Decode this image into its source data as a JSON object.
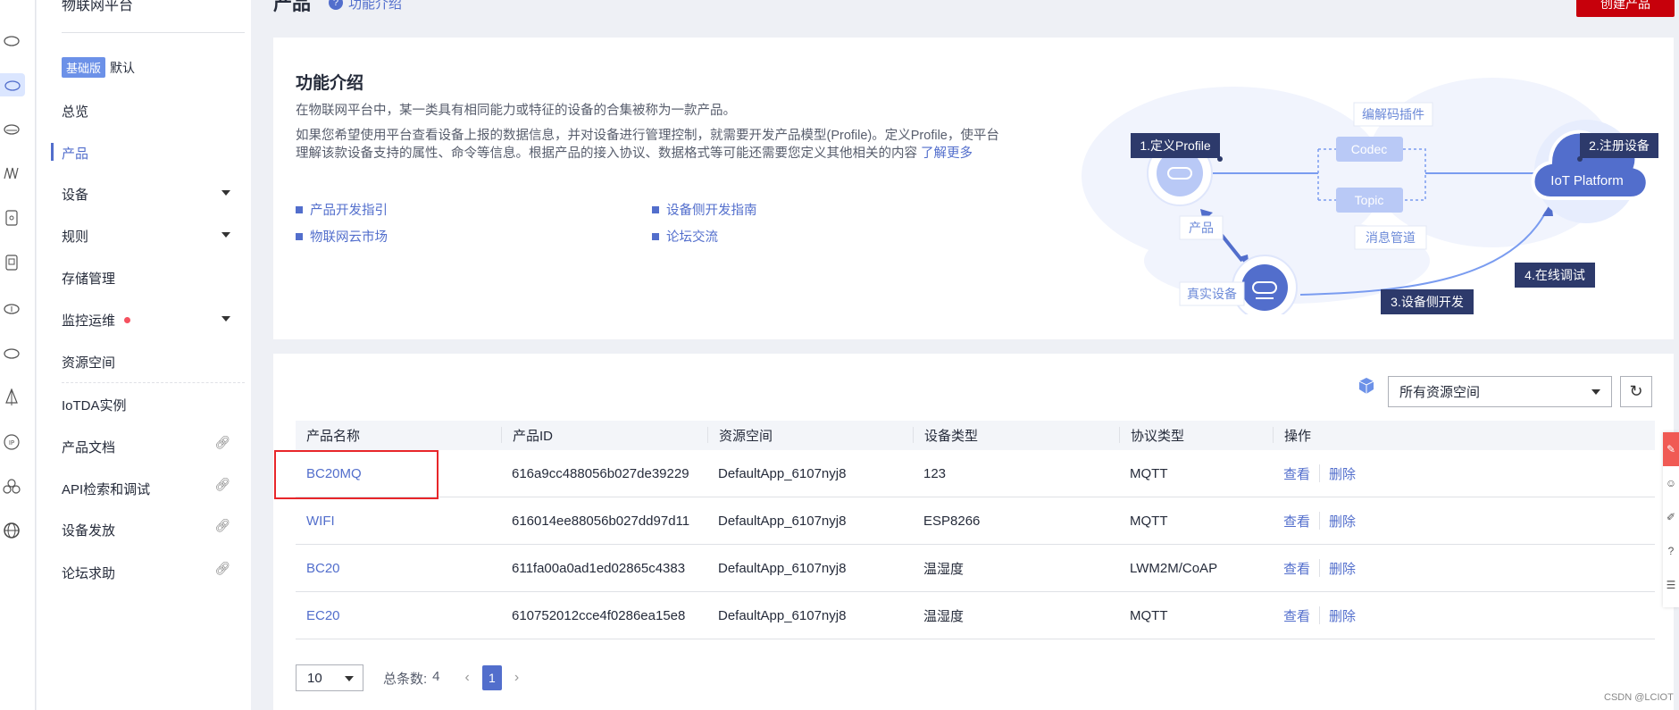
{
  "app": {
    "title": "物联网平台",
    "edition_badge": "基础版",
    "edition_text": "默认"
  },
  "sidebar": {
    "items": [
      {
        "label": "总览"
      },
      {
        "label": "产品",
        "active": true
      },
      {
        "label": "设备"
      },
      {
        "label": "规则"
      },
      {
        "label": "存储管理"
      },
      {
        "label": "监控运维"
      },
      {
        "label": "资源空间"
      },
      {
        "label": "IoTDA实例"
      },
      {
        "label": "产品文档"
      },
      {
        "label": "API检索和调试"
      },
      {
        "label": "设备发放"
      },
      {
        "label": "论坛求助"
      }
    ]
  },
  "header": {
    "title": "产品",
    "intro_link": "功能介绍",
    "create_label": "创建产品"
  },
  "intro": {
    "title": "功能介绍",
    "p1": "在物联网平台中，某一类具有相同能力或特征的设备的合集被称为一款产品。",
    "p2": "如果您希望使用平台查看设备上报的数据信息，并对设备进行管理控制，就需要开发产品模型(Profile)。定义Profile，使平台理解该款设备支持的属性、命令等信息。根据产品的接入协议、数据格式等可能还需要您定义其他相关的内容",
    "p2_link": "了解更多",
    "links": [
      "产品开发指引",
      "设备侧开发指南",
      "物联网云市场",
      "论坛交流"
    ]
  },
  "diagram": {
    "step1": "1.定义Profile",
    "step2": "2.注册设备",
    "step3": "3.设备侧开发",
    "step4": "4.在线调试",
    "codec_plugin": "编解码插件",
    "codec": "Codec",
    "topic": "Topic",
    "msg_pipe": "消息管道",
    "product": "产品",
    "real_device": "真实设备",
    "platform": "IoT Platform"
  },
  "colors": {
    "accent": "#526ecc",
    "brand_red": "#c7000b",
    "highlight": "#e8262a"
  },
  "filter": {
    "resource_space": "所有资源空间"
  },
  "table": {
    "headers": [
      "产品名称",
      "产品ID",
      "资源空间",
      "设备类型",
      "协议类型",
      "操作"
    ],
    "rows": [
      {
        "name": "BC20MQ",
        "id": "616a9cc488056b027de39229",
        "space": "DefaultApp_6107nyj8",
        "type": "123",
        "protocol": "MQTT",
        "view": "查看",
        "del": "删除"
      },
      {
        "name": "WIFI",
        "id": "616014ee88056b027dd97d11",
        "space": "DefaultApp_6107nyj8",
        "type": "ESP8266",
        "protocol": "MQTT",
        "view": "查看",
        "del": "删除"
      },
      {
        "name": "BC20",
        "id": "611fa00a0ad1ed02865c4383",
        "space": "DefaultApp_6107nyj8",
        "type": "温湿度",
        "protocol": "LWM2M/CoAP",
        "view": "查看",
        "del": "删除"
      },
      {
        "name": "EC20",
        "id": "610752012cce4f0286ea15e8",
        "space": "DefaultApp_6107nyj8",
        "type": "温湿度",
        "protocol": "MQTT",
        "view": "查看",
        "del": "删除"
      }
    ]
  },
  "pager": {
    "page_size": "10",
    "total_label": "总条数:",
    "total": "4",
    "page": "1"
  },
  "watermark": "CSDN @LCIOT"
}
